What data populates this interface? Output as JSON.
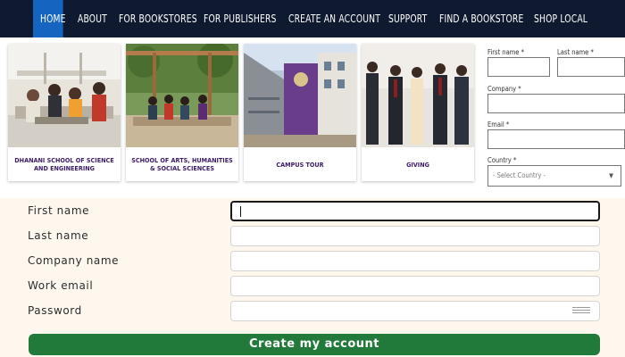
{
  "nav": {
    "items": [
      "HOME",
      "ABOUT",
      "FOR BOOKSTORES",
      "FOR PUBLISHERS",
      "CREATE AN ACCOUNT",
      "SUPPORT",
      "FIND A BOOKSTORE",
      "SHOP LOCAL"
    ],
    "active_index": 0,
    "accent": "#1565c0",
    "bg": "#0f1a30"
  },
  "cards": [
    {
      "caption": "DHANANI SCHOOL OF SCIENCE AND ENGINEERING"
    },
    {
      "caption": "SCHOOL OF ARTS, HUMANITIES & SOCIAL SCIENCES"
    },
    {
      "caption": "CAMPUS TOUR"
    },
    {
      "caption": "GIVING"
    }
  ],
  "mini_form": {
    "first_name_label": "First name *",
    "last_name_label": "Last name *",
    "company_label": "Company *",
    "email_label": "Email *",
    "country_label": "Country *",
    "country_value": "- Select Country -"
  },
  "signup": {
    "first_name_label": "First name",
    "last_name_label": "Last name",
    "company_label": "Company name",
    "email_label": "Work email",
    "password_label": "Password",
    "submit_label": "Create my account",
    "submit_color": "#217a3a"
  }
}
